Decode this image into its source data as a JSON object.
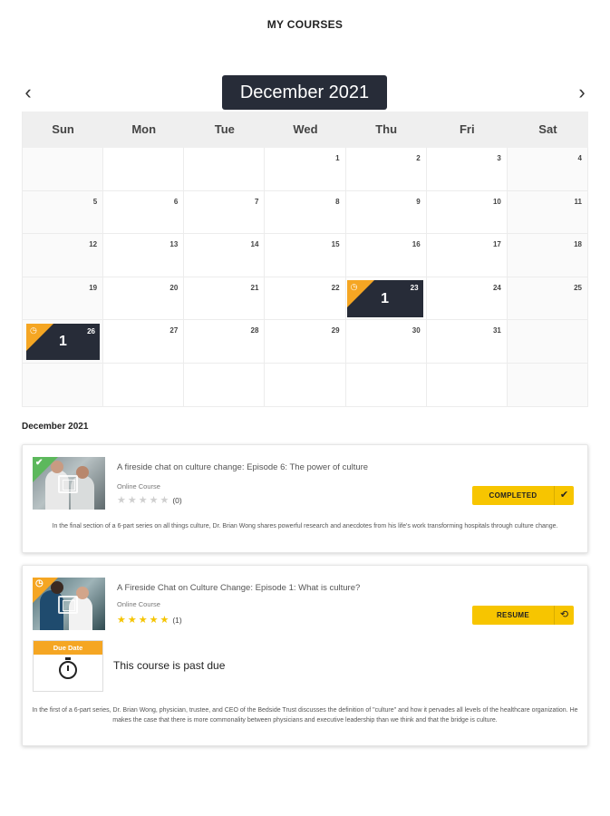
{
  "page": {
    "title": "MY COURSES"
  },
  "calendar": {
    "month_label": "December 2021",
    "prev_arrow": "‹",
    "next_arrow": "›",
    "weekdays": [
      "Sun",
      "Mon",
      "Tue",
      "Wed",
      "Thu",
      "Fri",
      "Sat"
    ],
    "weeks": [
      [
        "",
        "",
        "",
        "1",
        "2",
        "3",
        "4"
      ],
      [
        "5",
        "6",
        "7",
        "8",
        "9",
        "10",
        "11"
      ],
      [
        "12",
        "13",
        "14",
        "15",
        "16",
        "17",
        "18"
      ],
      [
        "19",
        "20",
        "21",
        "22",
        "23",
        "24",
        "25"
      ],
      [
        "26",
        "27",
        "28",
        "29",
        "30",
        "31",
        ""
      ],
      [
        "",
        "",
        "",
        "",
        "",
        "",
        ""
      ]
    ],
    "events": [
      {
        "date": "23",
        "count": "1",
        "icon": "clock-icon"
      },
      {
        "date": "26",
        "count": "1",
        "icon": "clock-icon"
      }
    ]
  },
  "list_month": "December 2021",
  "courses": [
    {
      "title": "A fireside chat on culture change: Episode 6: The power of culture",
      "type": "Online Course",
      "stars": "★★★★★",
      "rating_count": "(0)",
      "status_label": "COMPLETED",
      "status_icon": "✔",
      "status_icon_name": "checkmark-icon",
      "description": "In the final section of a 6-part series on all things culture, Dr. Brian Wong shares powerful research and anecdotes from his life's work transforming hospitals through culture change."
    },
    {
      "title": "A Fireside Chat on Culture Change: Episode 1: What is culture?",
      "type": "Online Course",
      "stars": "★★★★★",
      "rating_count": "(1)",
      "status_label": "RESUME",
      "status_icon": "⟲",
      "status_icon_name": "resume-icon",
      "due_label": "Due Date",
      "past_due_text": "This course is past due",
      "description": "In the first of a 6-part series, Dr. Brian Wong, physician, trustee, and CEO of the Bedside Trust discusses the definition of \"culture\" and how it pervades all levels of the healthcare organization. He makes the case that there is more commonality between physicians and executive leadership than we think and that the bridge is culture."
    }
  ],
  "colors": {
    "accent_yellow": "#f7c500",
    "flag_orange": "#f5a623",
    "flag_green": "#5cb85c",
    "dark_navy": "#272c38"
  }
}
